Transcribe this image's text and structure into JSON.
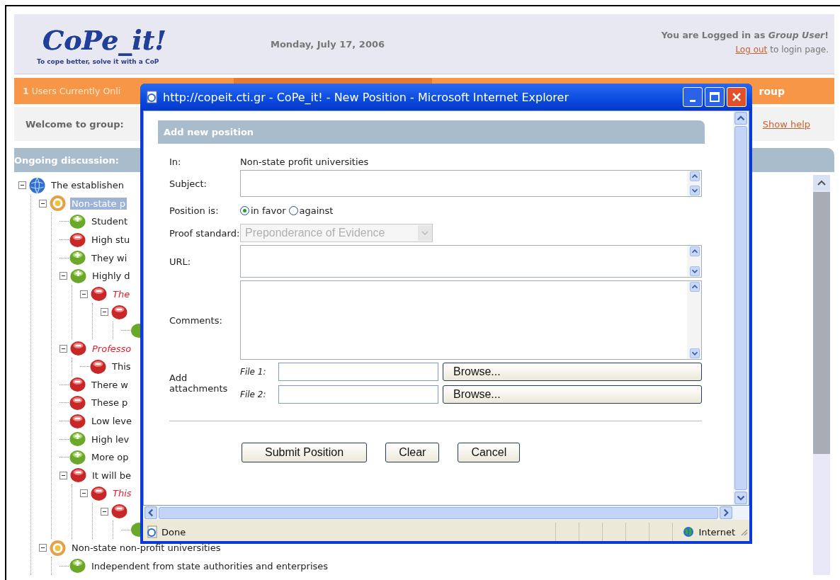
{
  "header": {
    "logo": "CoPe_it!",
    "tagline": "To cope better, solve it with a CoP",
    "date": "Monday, July 17, 2006",
    "login_text": "You are Logged in as *Group User*!",
    "logout_link": "Log out",
    "logout_suffix": "to login page."
  },
  "online_bar": {
    "text": "**1** Users Currently Onli",
    "right_text": "roup"
  },
  "welcome": {
    "text": "Welcome to group:",
    "help_link": "Show help"
  },
  "discussion": {
    "title": "Ongoing discussion:"
  },
  "tree": [
    {
      "kind": "topic",
      "text": "The establishen",
      "expanded": true,
      "selected": false,
      "emphasized": false,
      "children": [
        {
          "kind": "issue",
          "text": "Non-state p",
          "expanded": true,
          "selected": true,
          "emphasized": false,
          "children": [
            {
              "kind": "pro",
              "text": "Student",
              "expanded": false,
              "selected": false,
              "emphasized": false
            },
            {
              "kind": "con",
              "text": "High stu",
              "expanded": false,
              "selected": false,
              "emphasized": false
            },
            {
              "kind": "pro",
              "text": "They wi",
              "expanded": false,
              "selected": false,
              "emphasized": false
            },
            {
              "kind": "pro",
              "text": "Highly d",
              "expanded": true,
              "selected": false,
              "emphasized": false,
              "children": [
                {
                  "kind": "con",
                  "text": "The",
                  "expanded": true,
                  "selected": false,
                  "emphasized": true,
                  "children": [
                    {
                      "kind": "con",
                      "expanded": true,
                      "children": [
                        {
                          "kind": "pro",
                          "partial": true
                        }
                      ]
                    }
                  ]
                }
              ]
            },
            {
              "kind": "con",
              "text": "Professo",
              "expanded": true,
              "selected": false,
              "emphasized": true,
              "children": [
                {
                  "kind": "con",
                  "text": "This",
                  "expanded": false,
                  "selected": false,
                  "emphasized": false
                }
              ]
            },
            {
              "kind": "con",
              "text": "There w",
              "expanded": false,
              "selected": false,
              "emphasized": false
            },
            {
              "kind": "con",
              "text": "These p",
              "expanded": false,
              "selected": false,
              "emphasized": false
            },
            {
              "kind": "con",
              "text": "Low leve",
              "expanded": false,
              "selected": false,
              "emphasized": false
            },
            {
              "kind": "pro",
              "text": "High lev",
              "expanded": false,
              "selected": false,
              "emphasized": false
            },
            {
              "kind": "pro",
              "text": "More op",
              "expanded": false,
              "selected": false,
              "emphasized": false
            },
            {
              "kind": "con",
              "text": "It will be",
              "expanded": true,
              "selected": false,
              "emphasized": false,
              "children": [
                {
                  "kind": "con",
                  "text": "This",
                  "expanded": true,
                  "selected": false,
                  "emphasized": true,
                  "children": [
                    {
                      "kind": "con",
                      "expanded": true,
                      "children": [
                        {
                          "kind": "pro",
                          "partial": true
                        }
                      ]
                    }
                  ]
                }
              ]
            }
          ]
        },
        {
          "kind": "issue",
          "text": "Non-state non-profit universities",
          "expanded": true,
          "selected": false,
          "emphasized": false,
          "children": [
            {
              "kind": "pro",
              "text": "Independent from state authorities and enterprises",
              "selected": false,
              "emphasized": false
            }
          ]
        }
      ]
    }
  ],
  "popup": {
    "title": "http://copeit.cti.gr - CoPe_it! - New Position - Microsoft Internet Explorer",
    "heading": "Add new position",
    "in_label": "In:",
    "in_value": "Non-state profit universities",
    "subject_label": "Subject:",
    "position_label": "Position is:",
    "position_options": [
      {
        "label": "in favor",
        "selected": true
      },
      {
        "label": "against",
        "selected": false
      }
    ],
    "proof_label": "Proof standard:",
    "proof_value": "Preponderance of Evidence",
    "proof_disabled": true,
    "url_label": "URL:",
    "comments_label": "Comments:",
    "attachments_label": "Add attachments",
    "files": [
      {
        "label": "File 1:",
        "button": "Browse..."
      },
      {
        "label": "File 2:",
        "button": "Browse..."
      }
    ],
    "buttons": [
      "Submit Position",
      "Clear",
      "Cancel"
    ],
    "status": "Done",
    "zone": "Internet"
  }
}
